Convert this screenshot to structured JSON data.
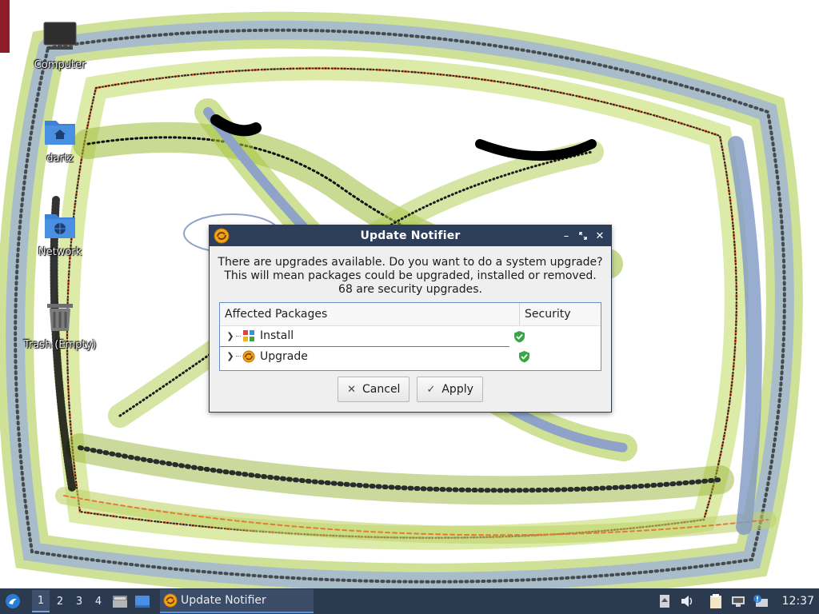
{
  "desktop": {
    "icons": [
      {
        "label": "Computer",
        "icon": "computer-icon"
      },
      {
        "label": "dartz",
        "icon": "home-folder-icon"
      },
      {
        "label": "Network",
        "icon": "network-folder-icon"
      },
      {
        "label": "Trash (Empty)",
        "icon": "trash-icon"
      }
    ]
  },
  "dialog": {
    "title": "Update Notifier",
    "message_line1": "There are upgrades available. Do you want to do a system upgrade?",
    "message_line2": "This will mean packages could be upgraded, installed or removed.",
    "message_line3": "68 are security upgrades.",
    "columns": {
      "packages": "Affected Packages",
      "security": "Security"
    },
    "rows": [
      {
        "label": "Install",
        "icon": "install-packages-icon",
        "security_icon": "shield-check-icon"
      },
      {
        "label": "Upgrade",
        "icon": "upgrade-icon",
        "security_icon": "shield-check-icon"
      }
    ],
    "buttons": {
      "cancel": "Cancel",
      "apply": "Apply"
    }
  },
  "taskbar": {
    "workspaces": [
      "1",
      "2",
      "3",
      "4"
    ],
    "active_workspace": "1",
    "task": {
      "label": "Update Notifier"
    },
    "clock": "12:37"
  },
  "colors": {
    "titlebar": "#2c3e5a",
    "taskbar": "#2c3a4f",
    "folder_blue": "#3d82d6",
    "shield_green": "#3aa543"
  }
}
